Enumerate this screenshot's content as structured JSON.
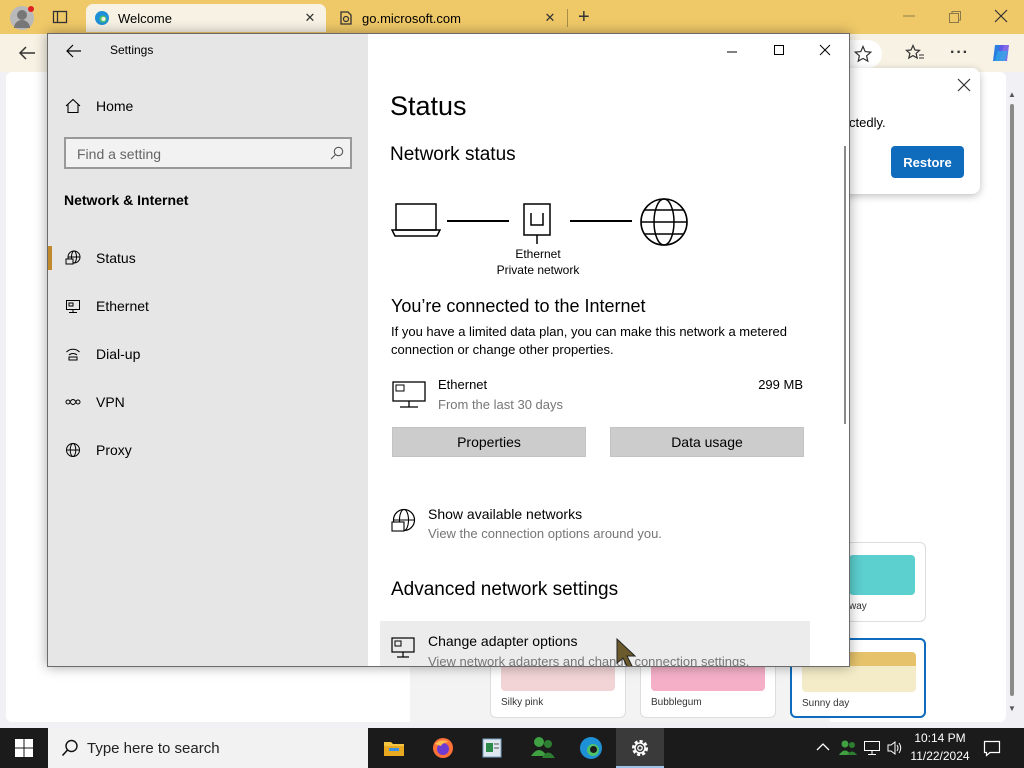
{
  "browser": {
    "tabs": [
      {
        "label": "Welcome"
      },
      {
        "label": "go.microsoft.com"
      }
    ],
    "popup": {
      "text": "ctedly.",
      "restore_label": "Restore"
    },
    "themes": [
      {
        "label": "way",
        "color": "#5ccfcf"
      },
      {
        "label": "Silky pink",
        "color": "#f2d4d6"
      },
      {
        "label": "Bubblegum",
        "color": "#f5b0c8"
      },
      {
        "label": "Sunny day",
        "color": "#e6c36b"
      }
    ]
  },
  "settings": {
    "window_title": "Settings",
    "sidebar": {
      "home_label": "Home",
      "search_placeholder": "Find a setting",
      "section_title": "Network & Internet",
      "items": [
        {
          "label": "Status",
          "icon": "status-icon",
          "selected": true
        },
        {
          "label": "Ethernet",
          "icon": "ethernet-icon"
        },
        {
          "label": "Dial-up",
          "icon": "dialup-icon"
        },
        {
          "label": "VPN",
          "icon": "vpn-icon"
        },
        {
          "label": "Proxy",
          "icon": "proxy-icon"
        }
      ]
    },
    "main": {
      "title": "Status",
      "network_status_heading": "Network status",
      "diagram_label_1": "Ethernet",
      "diagram_label_2": "Private network",
      "connected_heading": "You’re connected to the Internet",
      "connected_desc": "If you have a limited data plan, you can make this network a metered connection or change other properties.",
      "connection": {
        "name": "Ethernet",
        "sub": "From the last 30 days",
        "usage": "299 MB"
      },
      "properties_label": "Properties",
      "data_usage_label": "Data usage",
      "show_networks": {
        "title": "Show available networks",
        "desc": "View the connection options around you."
      },
      "advanced_heading": "Advanced network settings",
      "change_adapter": {
        "title": "Change adapter options",
        "desc": "View network adapters and change connection settings."
      }
    }
  },
  "taskbar": {
    "search_placeholder": "Type here to search",
    "time": "10:14 PM",
    "date": "11/22/2024"
  },
  "colors": {
    "accent": "#0f6cbd",
    "edge_tabbar": "#efc868",
    "taskbar": "#1b1b1b"
  }
}
